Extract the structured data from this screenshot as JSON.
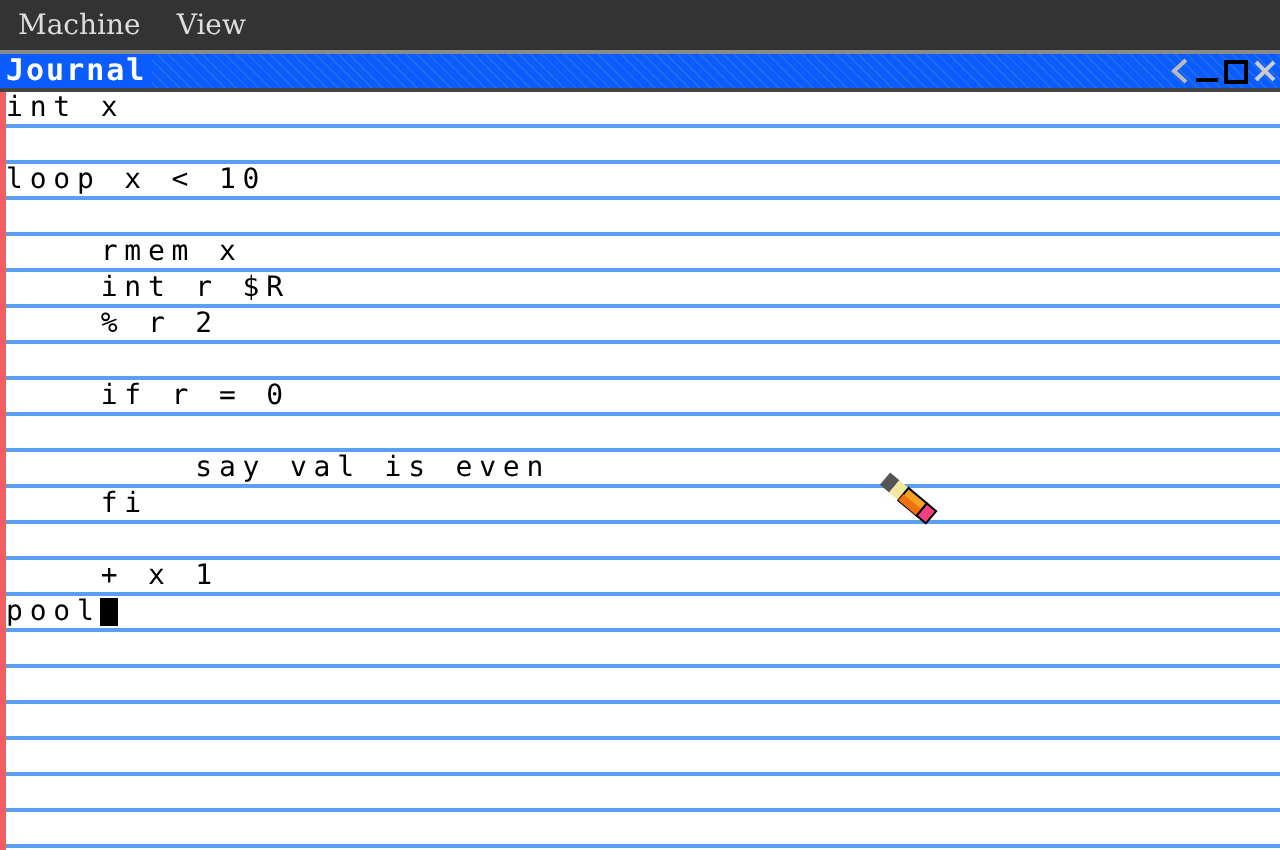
{
  "menu_bar": {
    "items": [
      "Machine",
      "View"
    ]
  },
  "window": {
    "title": "Journal"
  },
  "editor": {
    "lines": [
      {
        "kind": "code",
        "text": "int x",
        "cursor": false
      },
      {
        "kind": "blank"
      },
      {
        "kind": "code",
        "text": "loop x < 10",
        "cursor": false
      },
      {
        "kind": "blank"
      },
      {
        "kind": "code",
        "text": "    rmem x",
        "cursor": false
      },
      {
        "kind": "code",
        "text": "    int r $R",
        "cursor": false
      },
      {
        "kind": "code",
        "text": "    % r 2",
        "cursor": false
      },
      {
        "kind": "blank"
      },
      {
        "kind": "code",
        "text": "    if r = 0",
        "cursor": false
      },
      {
        "kind": "blank"
      },
      {
        "kind": "code",
        "text": "        say val is even",
        "cursor": false
      },
      {
        "kind": "code",
        "text": "    fi",
        "cursor": false
      },
      {
        "kind": "blank"
      },
      {
        "kind": "code",
        "text": "    + x 1",
        "cursor": false
      },
      {
        "kind": "code",
        "text": "pool",
        "cursor": true
      }
    ]
  }
}
